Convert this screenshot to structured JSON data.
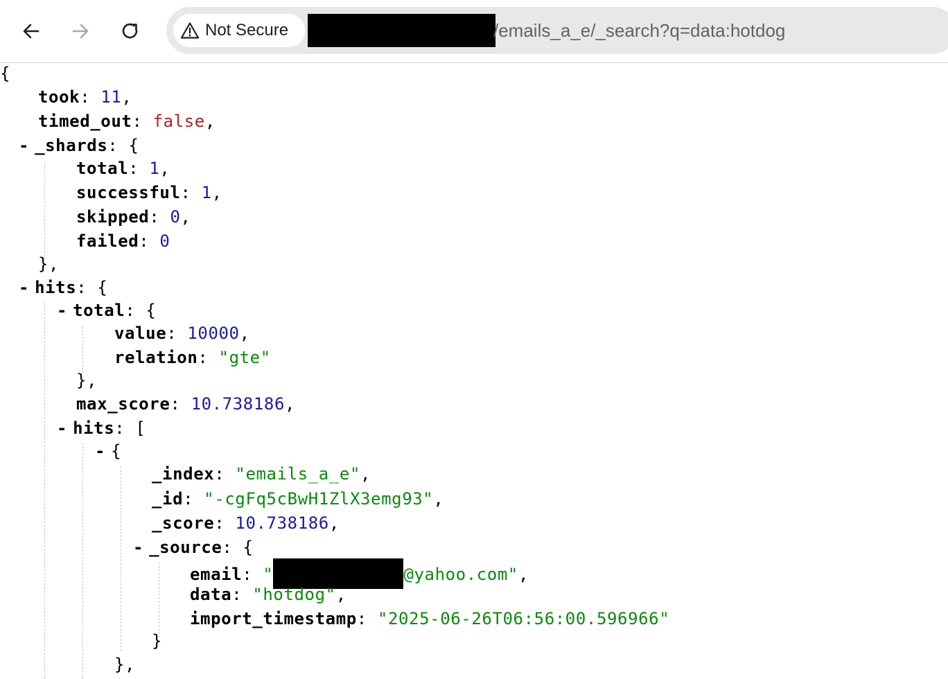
{
  "browser": {
    "security_label": "Not Secure",
    "url_visible": "/emails_a_e/_search?q=data:hotdog",
    "icons": {
      "back": "arrow-left-icon",
      "forward": "arrow-right-icon",
      "reload": "reload-icon",
      "warning": "warning-triangle-icon"
    }
  },
  "json": {
    "open_brace": "{",
    "took": {
      "key": "took",
      "value": "11"
    },
    "timed_out": {
      "key": "timed_out",
      "value": "false"
    },
    "shards": {
      "key": "_shards",
      "total": {
        "key": "total",
        "value": "1"
      },
      "successful": {
        "key": "successful",
        "value": "1"
      },
      "skipped": {
        "key": "skipped",
        "value": "0"
      },
      "failed": {
        "key": "failed",
        "value": "0"
      }
    },
    "hits": {
      "key": "hits",
      "total": {
        "key": "total",
        "value": {
          "key": "value",
          "value": "10000"
        },
        "relation": {
          "key": "relation",
          "value": "\"gte\""
        }
      },
      "max_score": {
        "key": "max_score",
        "value": "10.738186"
      },
      "hits_array": {
        "key": "hits",
        "first": {
          "index": {
            "key": "_index",
            "value": "\"emails_a_e\""
          },
          "id": {
            "key": "_id",
            "value": "\"-cgFq5cBwH1ZlX3emg93\""
          },
          "score": {
            "key": "_score",
            "value": "10.738186"
          },
          "source": {
            "key": "_source",
            "email": {
              "key": "email",
              "value_prefix": "\"",
              "value_suffix": "@yahoo.com\""
            },
            "data": {
              "key": "data",
              "value": "\"hotdog\""
            },
            "import_timestamp": {
              "key": "import_timestamp",
              "value": "\"2025-06-26T06:56:00.596966\""
            }
          }
        }
      }
    },
    "toggle_symbol": "-"
  },
  "colors": {
    "key": "#000000",
    "number": "#1a1aa6",
    "string": "#098a09",
    "boolean": "#b22222"
  }
}
